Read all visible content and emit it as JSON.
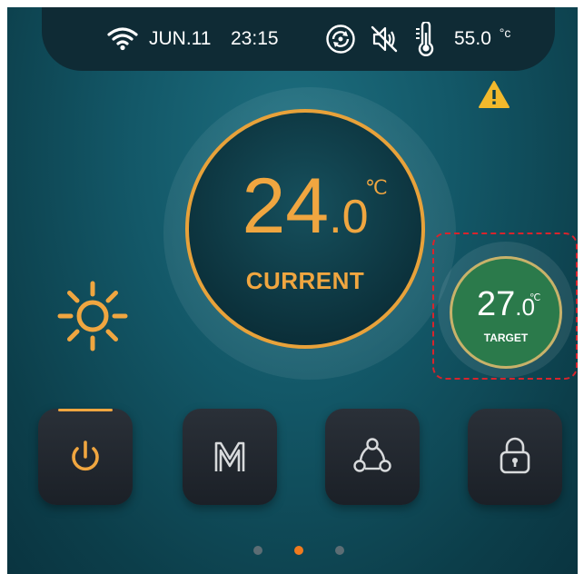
{
  "status_bar": {
    "date": "JUN.11",
    "time": "23:15",
    "water_temp": "55.0",
    "water_temp_unit": "°c",
    "icons": [
      "wifi-icon",
      "circulation-icon",
      "mute-icon",
      "thermometer-icon"
    ]
  },
  "warning": {
    "icon": "warning-icon",
    "color": "#f2b92c"
  },
  "current": {
    "whole": "24",
    "decimal": ".0",
    "unit": "℃",
    "label": "CURRENT"
  },
  "mode": {
    "icon": "sun-icon"
  },
  "target": {
    "whole": "27",
    "decimal": ".0",
    "unit": "℃",
    "label": "TARGET"
  },
  "buttons": [
    {
      "name": "power",
      "icon": "power-icon",
      "active": true
    },
    {
      "name": "mode",
      "icon": "m-mode-icon",
      "active": false
    },
    {
      "name": "link",
      "icon": "share-network-icon",
      "active": false
    },
    {
      "name": "lock",
      "icon": "lock-icon",
      "active": false
    }
  ],
  "pager": {
    "count": 3,
    "active": 2
  },
  "colors": {
    "accent": "#f0a640",
    "target_green": "#2b7a4b",
    "highlight_dash": "#d8242c",
    "status_bar": "#0f2b35"
  }
}
